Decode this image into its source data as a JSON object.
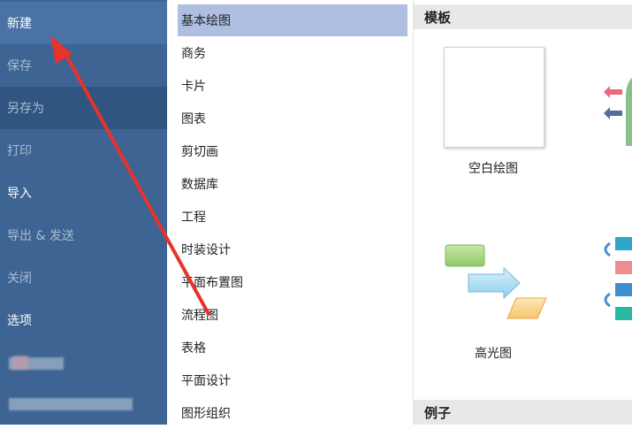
{
  "left_menu": {
    "items": [
      {
        "label": "新建"
      },
      {
        "label": "保存"
      },
      {
        "label": "另存为"
      },
      {
        "label": "打印"
      },
      {
        "label": "导入"
      },
      {
        "label": "导出 & 发送"
      },
      {
        "label": "关闭"
      },
      {
        "label": "选项"
      }
    ]
  },
  "categories": {
    "items": [
      {
        "label": "基本绘图"
      },
      {
        "label": "商务"
      },
      {
        "label": "卡片"
      },
      {
        "label": "图表"
      },
      {
        "label": "剪切画"
      },
      {
        "label": "数据库"
      },
      {
        "label": "工程"
      },
      {
        "label": "时装设计"
      },
      {
        "label": "平面布置图"
      },
      {
        "label": "流程图"
      },
      {
        "label": "表格"
      },
      {
        "label": "平面设计"
      },
      {
        "label": "图形组织"
      }
    ]
  },
  "templates_section": {
    "title": "模板",
    "items": [
      {
        "label": "空白绘图"
      },
      {
        "label": "高光图"
      }
    ]
  },
  "examples_section": {
    "title": "例子"
  },
  "colors": {
    "menu_bg": "#3d6493",
    "selected_category": "#aebfe2",
    "annotation_arrow": "#e8322c"
  }
}
